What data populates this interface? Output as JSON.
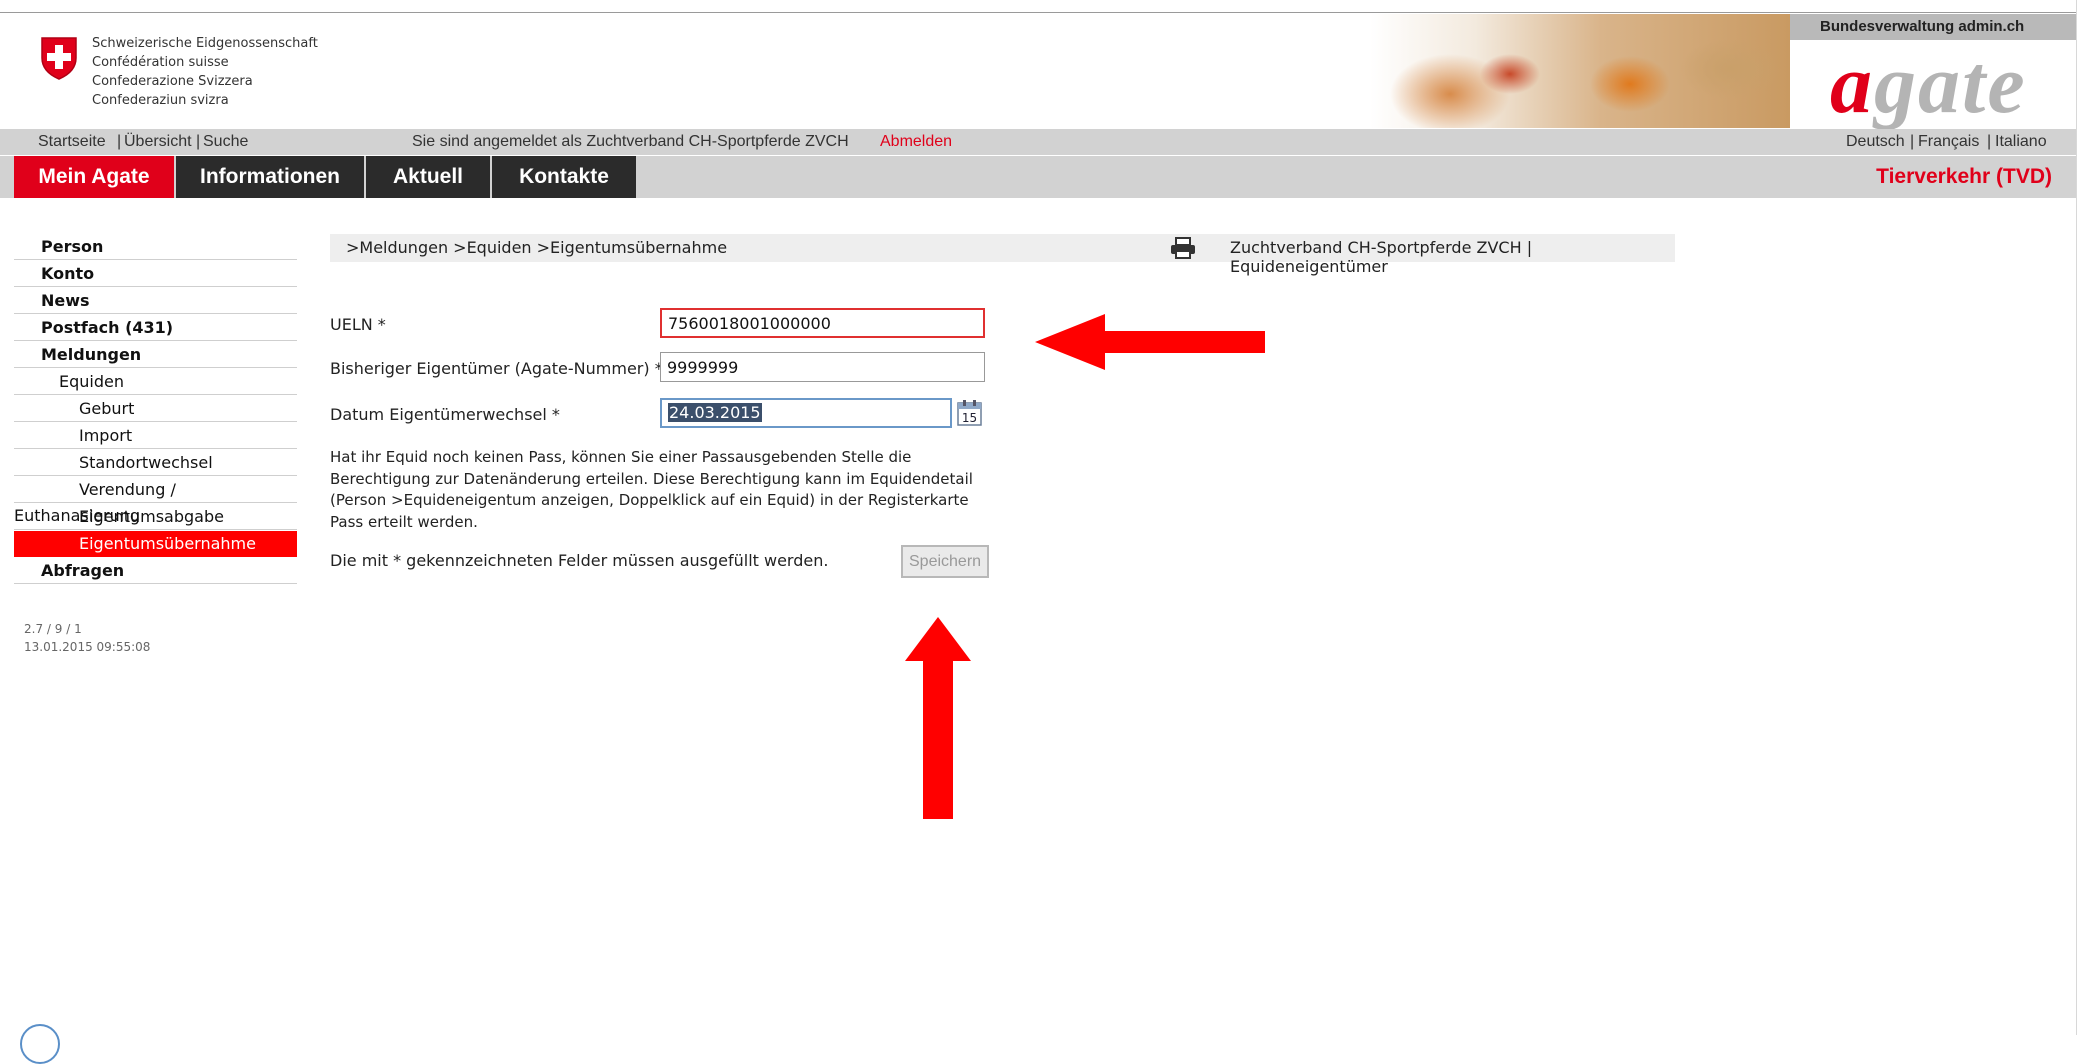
{
  "header": {
    "federation_lines": [
      "Schweizerische Eidgenossenschaft",
      "Confédération suisse",
      "Confederazione Svizzera",
      "Confederaziun svizra"
    ],
    "bv_label": "Bundesverwaltung admin.ch",
    "logo_a": "a",
    "logo_rest": "gate",
    "brand_red": "#e0001a"
  },
  "utility": {
    "startseite": "Startseite",
    "uebersicht": "Übersicht",
    "suche": "Suche",
    "sep": "|",
    "logged_in": "Sie sind angemeldet als Zuchtverband CH-Sportpferde ZVCH",
    "logout": "Abmelden",
    "lang_de": "Deutsch",
    "lang_fr": "Français",
    "lang_it": "Italiano"
  },
  "nav": {
    "tabs": [
      "Mein Agate",
      "Informationen",
      "Aktuell",
      "Kontakte"
    ],
    "right_label": "Tierverkehr (TVD)"
  },
  "sidebar": {
    "items": [
      {
        "label": "Person"
      },
      {
        "label": "Konto"
      },
      {
        "label": "News"
      },
      {
        "label": "Postfach (431)"
      },
      {
        "label": "Meldungen"
      },
      {
        "label": "Equiden"
      },
      {
        "label": "Geburt"
      },
      {
        "label": "Import"
      },
      {
        "label": "Standortwechsel"
      },
      {
        "label": "Verendung / Euthanasierung"
      },
      {
        "label": "Eigentumsabgabe"
      },
      {
        "label": "Eigentumsübernahme"
      },
      {
        "label": "Abfragen"
      }
    ],
    "version": "2.7 / 9 / 1",
    "timestamp": "13.01.2015 09:55:08"
  },
  "breadcrumb": {
    "path": ">Meldungen >Equiden >Eigentumsübernahme",
    "user_role": "Zuchtverband CH-Sportpferde ZVCH | Equideneigentümer",
    "printer_icon": "printer-icon"
  },
  "form": {
    "ueln_label": "UELN *",
    "ueln_value": "7560018001000000",
    "owner_label": "Bisheriger Eigentümer (Agate-Nummer) *",
    "owner_value": "9999999",
    "date_label": "Datum Eigentümerwechsel *",
    "date_value": "24.03.2015",
    "calendar_day": "15",
    "info_text": "Hat ihr Equid noch keinen Pass, können Sie einer Passausgebenden Stelle die Berechtigung zur Datenänderung erteilen. Diese Berechtigung kann im Equidendetail (Person >Equideneigentum anzeigen, Doppelklick auf ein Equid) in der Registerkarte Pass erteilt werden.",
    "required_note": "Die mit * gekennzeichneten Felder müssen ausgefüllt werden.",
    "save_label": "Speichern"
  },
  "annotations": {
    "arrow_color": "#ff0000"
  }
}
